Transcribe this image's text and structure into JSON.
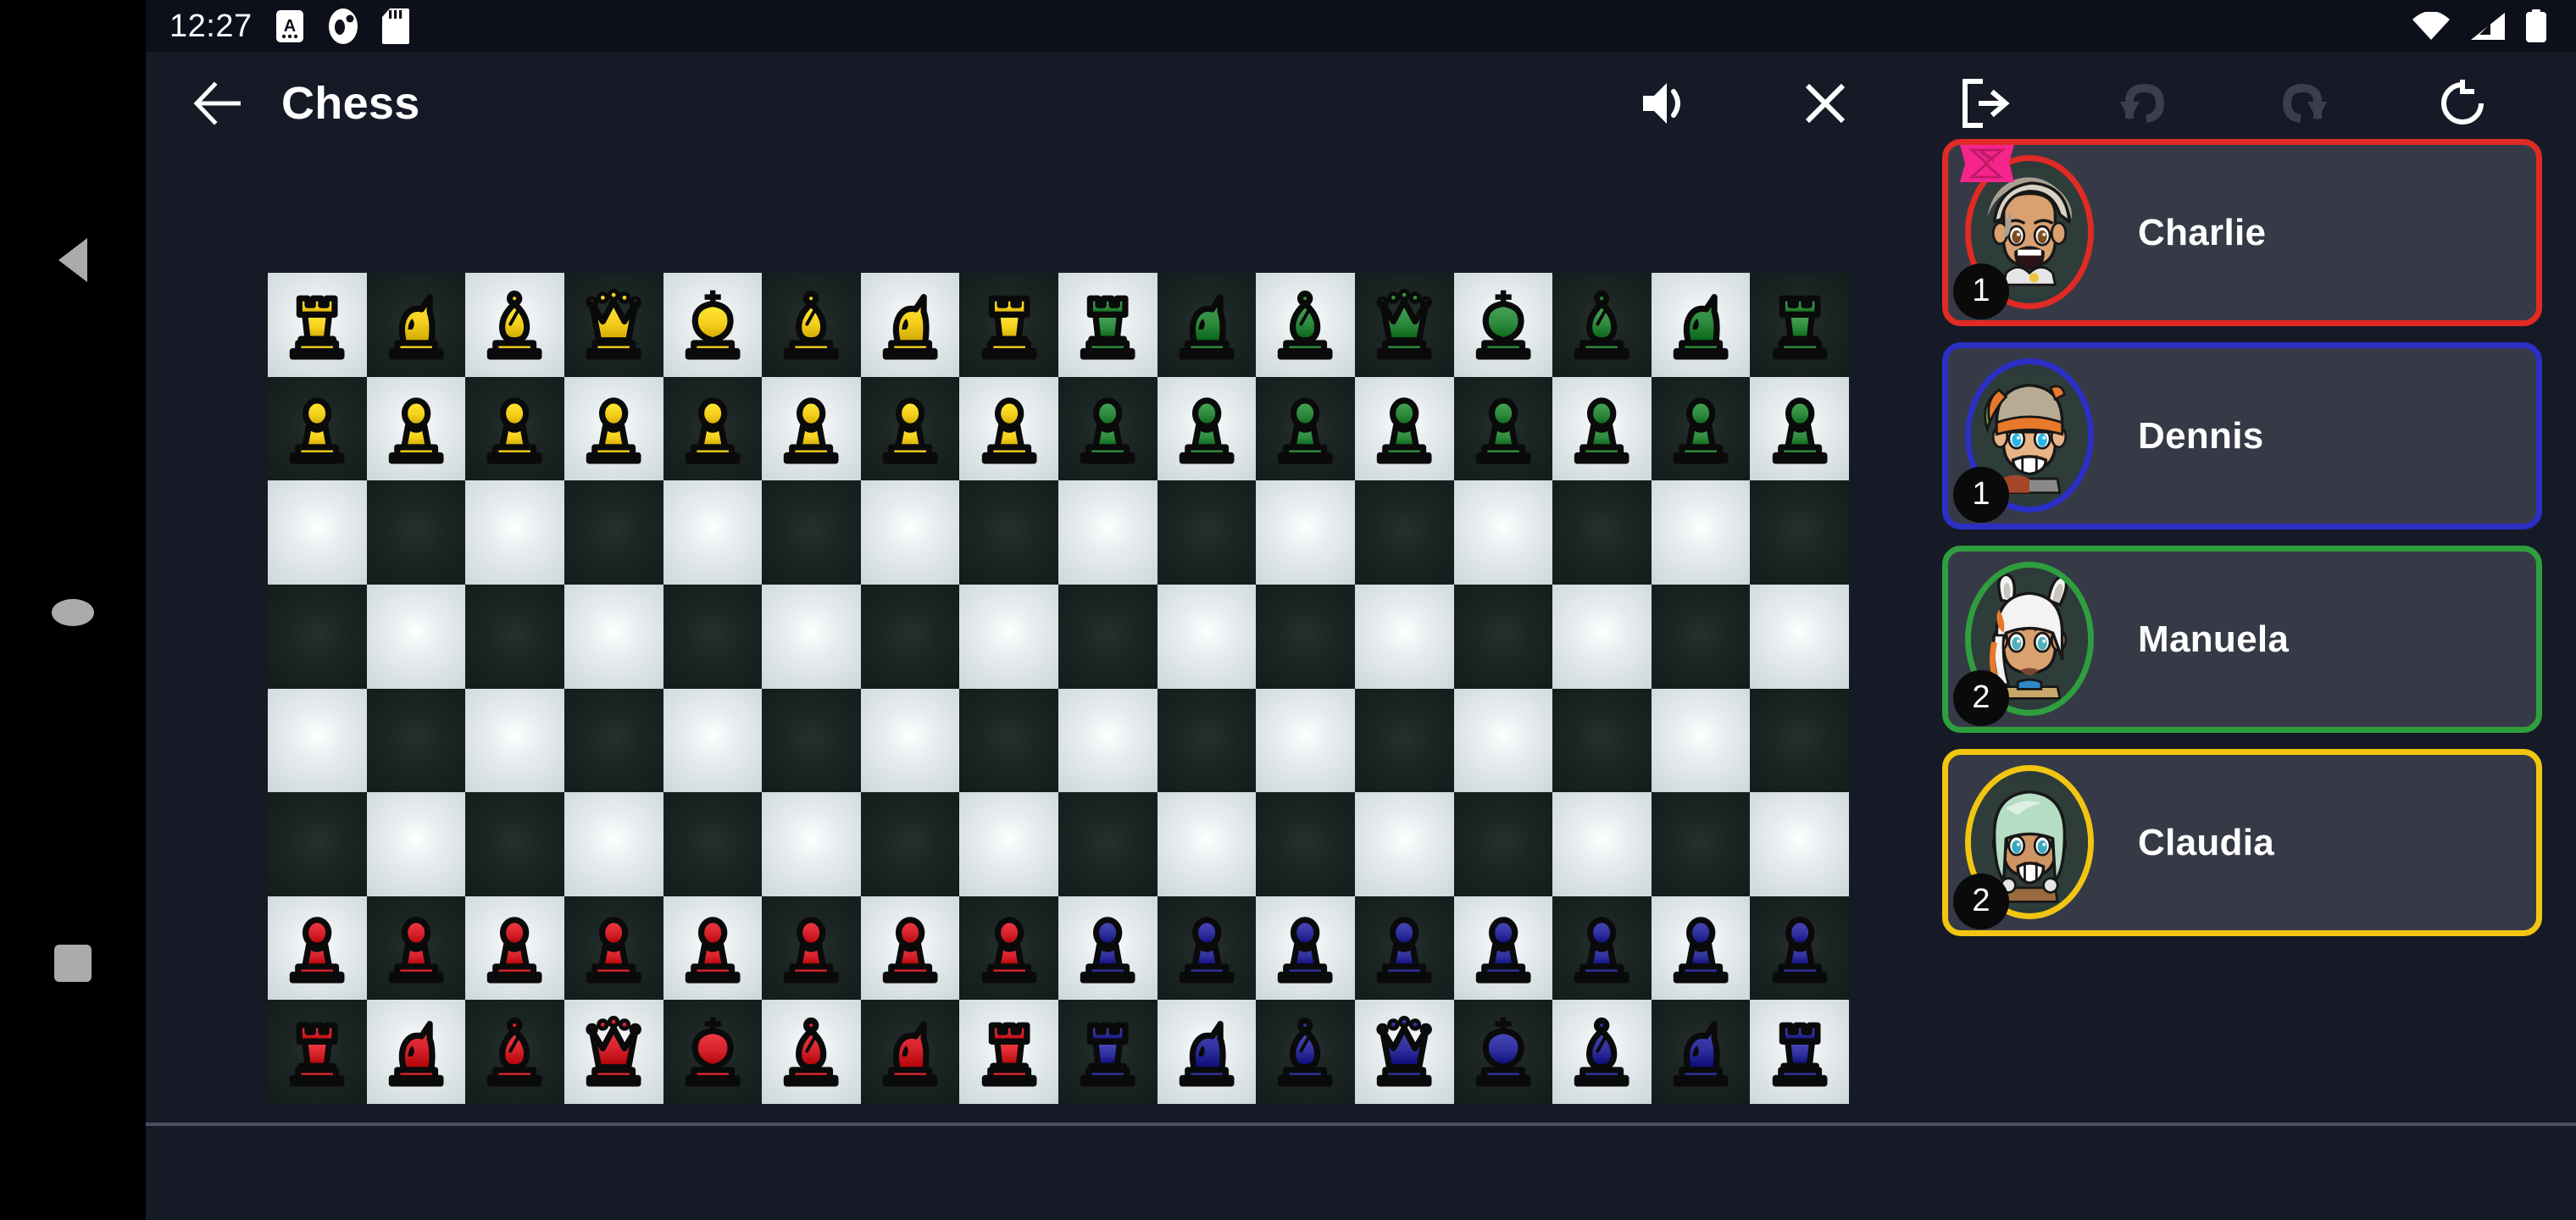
{
  "status_bar": {
    "time": "12:27",
    "left_icons": [
      "alarm-a-icon",
      "do-not-disturb-icon",
      "sd-card-icon"
    ],
    "right_icons": [
      "wifi-icon",
      "cellular-signal-icon",
      "battery-icon"
    ]
  },
  "nav_bar": {
    "items": [
      {
        "name": "back",
        "icon": "triangle-back-icon"
      },
      {
        "name": "home",
        "icon": "circle-home-icon"
      },
      {
        "name": "recents",
        "icon": "square-recents-icon"
      }
    ]
  },
  "header": {
    "back_label": "arrow-left-icon",
    "title": "Chess",
    "actions": [
      {
        "name": "sound",
        "icon": "volume-on-icon",
        "enabled": true
      },
      {
        "name": "close",
        "icon": "close-x-icon",
        "enabled": true
      },
      {
        "name": "exit",
        "icon": "exit-door-icon",
        "enabled": true
      },
      {
        "name": "undo",
        "icon": "undo-arrow-icon",
        "enabled": false
      },
      {
        "name": "redo",
        "icon": "redo-arrow-icon",
        "enabled": false
      },
      {
        "name": "restart",
        "icon": "refresh-circle-icon",
        "enabled": true
      }
    ]
  },
  "board": {
    "columns": 16,
    "rows": 8,
    "light_square_color": "#e9eef0",
    "dark_square_color": "#1b2523",
    "rows_data": [
      [
        {
          "color": "yellow",
          "type": "rook"
        },
        {
          "color": "yellow",
          "type": "knight"
        },
        {
          "color": "yellow",
          "type": "bishop"
        },
        {
          "color": "yellow",
          "type": "queen"
        },
        {
          "color": "yellow",
          "type": "king"
        },
        {
          "color": "yellow",
          "type": "bishop"
        },
        {
          "color": "yellow",
          "type": "knight"
        },
        {
          "color": "yellow",
          "type": "rook"
        },
        {
          "color": "green",
          "type": "rook"
        },
        {
          "color": "green",
          "type": "knight"
        },
        {
          "color": "green",
          "type": "bishop"
        },
        {
          "color": "green",
          "type": "queen"
        },
        {
          "color": "green",
          "type": "king"
        },
        {
          "color": "green",
          "type": "bishop"
        },
        {
          "color": "green",
          "type": "knight"
        },
        {
          "color": "green",
          "type": "rook"
        }
      ],
      [
        {
          "color": "yellow",
          "type": "pawn"
        },
        {
          "color": "yellow",
          "type": "pawn"
        },
        {
          "color": "yellow",
          "type": "pawn"
        },
        {
          "color": "yellow",
          "type": "pawn"
        },
        {
          "color": "yellow",
          "type": "pawn"
        },
        {
          "color": "yellow",
          "type": "pawn"
        },
        {
          "color": "yellow",
          "type": "pawn"
        },
        {
          "color": "yellow",
          "type": "pawn"
        },
        {
          "color": "green",
          "type": "pawn"
        },
        {
          "color": "green",
          "type": "pawn"
        },
        {
          "color": "green",
          "type": "pawn"
        },
        {
          "color": "green",
          "type": "pawn"
        },
        {
          "color": "green",
          "type": "pawn"
        },
        {
          "color": "green",
          "type": "pawn"
        },
        {
          "color": "green",
          "type": "pawn"
        },
        {
          "color": "green",
          "type": "pawn"
        }
      ],
      [
        null,
        null,
        null,
        null,
        null,
        null,
        null,
        null,
        null,
        null,
        null,
        null,
        null,
        null,
        null,
        null
      ],
      [
        null,
        null,
        null,
        null,
        null,
        null,
        null,
        null,
        null,
        null,
        null,
        null,
        null,
        null,
        null,
        null
      ],
      [
        null,
        null,
        null,
        null,
        null,
        null,
        null,
        null,
        null,
        null,
        null,
        null,
        null,
        null,
        null,
        null
      ],
      [
        null,
        null,
        null,
        null,
        null,
        null,
        null,
        null,
        null,
        null,
        null,
        null,
        null,
        null,
        null,
        null
      ],
      [
        {
          "color": "red",
          "type": "pawn"
        },
        {
          "color": "red",
          "type": "pawn"
        },
        {
          "color": "red",
          "type": "pawn"
        },
        {
          "color": "red",
          "type": "pawn"
        },
        {
          "color": "red",
          "type": "pawn"
        },
        {
          "color": "red",
          "type": "pawn"
        },
        {
          "color": "red",
          "type": "pawn"
        },
        {
          "color": "red",
          "type": "pawn"
        },
        {
          "color": "blue",
          "type": "pawn"
        },
        {
          "color": "blue",
          "type": "pawn"
        },
        {
          "color": "blue",
          "type": "pawn"
        },
        {
          "color": "blue",
          "type": "pawn"
        },
        {
          "color": "blue",
          "type": "pawn"
        },
        {
          "color": "blue",
          "type": "pawn"
        },
        {
          "color": "blue",
          "type": "pawn"
        },
        {
          "color": "blue",
          "type": "pawn"
        }
      ],
      [
        {
          "color": "red",
          "type": "rook"
        },
        {
          "color": "red",
          "type": "knight"
        },
        {
          "color": "red",
          "type": "bishop"
        },
        {
          "color": "red",
          "type": "queen"
        },
        {
          "color": "red",
          "type": "king"
        },
        {
          "color": "red",
          "type": "bishop"
        },
        {
          "color": "red",
          "type": "knight"
        },
        {
          "color": "red",
          "type": "rook"
        },
        {
          "color": "blue",
          "type": "rook"
        },
        {
          "color": "blue",
          "type": "knight"
        },
        {
          "color": "blue",
          "type": "bishop"
        },
        {
          "color": "blue",
          "type": "queen"
        },
        {
          "color": "blue",
          "type": "king"
        },
        {
          "color": "blue",
          "type": "bishop"
        },
        {
          "color": "blue",
          "type": "knight"
        },
        {
          "color": "blue",
          "type": "rook"
        }
      ]
    ],
    "piece_colors": {
      "yellow": "#f5cf1b",
      "green": "#2e8b3d",
      "red": "#d6212b",
      "blue": "#2f309e"
    }
  },
  "players": [
    {
      "name": "Charlie",
      "badge": "1",
      "border_color": "#e02a24",
      "is_turn": true,
      "turn_icon": "hourglass-icon",
      "turn_icon_color": "#f5258c",
      "avatar": {
        "name": "charlie-avatar",
        "hair": "#d9d3c6",
        "hair_shadow": "#a8a193",
        "skin": "#d9a070",
        "eye": "#7a4e22",
        "outfit": "#e6e6e6",
        "accent": "#f0c33c",
        "bg": "#2e3c3a"
      }
    },
    {
      "name": "Dennis",
      "badge": "1",
      "border_color": "#2b2fc4",
      "is_turn": false,
      "turn_icon": null,
      "turn_icon_color": null,
      "avatar": {
        "name": "dennis-avatar",
        "hair": "#b8ab94",
        "hair_shadow": "#8e8370",
        "skin": "#e8b387",
        "eye": "#29b6e8",
        "outfit": "#8a8a8a",
        "accent": "#e8792a",
        "bg": "#2e3c3a"
      }
    },
    {
      "name": "Manuela",
      "badge": "2",
      "border_color": "#2f9e3e",
      "is_turn": false,
      "turn_icon": null,
      "turn_icon_color": null,
      "avatar": {
        "name": "manuela-avatar",
        "hair": "#f3f3f3",
        "hair_shadow": "#c9c4bd",
        "skin": "#d9a070",
        "eye": "#4fb0b8",
        "outfit": "#c8a86a",
        "accent": "#e8792a",
        "bg": "#2e3c3a"
      }
    },
    {
      "name": "Claudia",
      "badge": "2",
      "border_color": "#f2c610",
      "is_turn": false,
      "turn_icon": null,
      "turn_icon_color": null,
      "avatar": {
        "name": "claudia-avatar",
        "hair": "#b5ddc4",
        "hair_shadow": "#8cc0a4",
        "skin": "#cf9463",
        "eye": "#3aa8bc",
        "outfit": "#9a6a40",
        "accent": "#e6e6e6",
        "bg": "#2e3c3a"
      }
    }
  ]
}
